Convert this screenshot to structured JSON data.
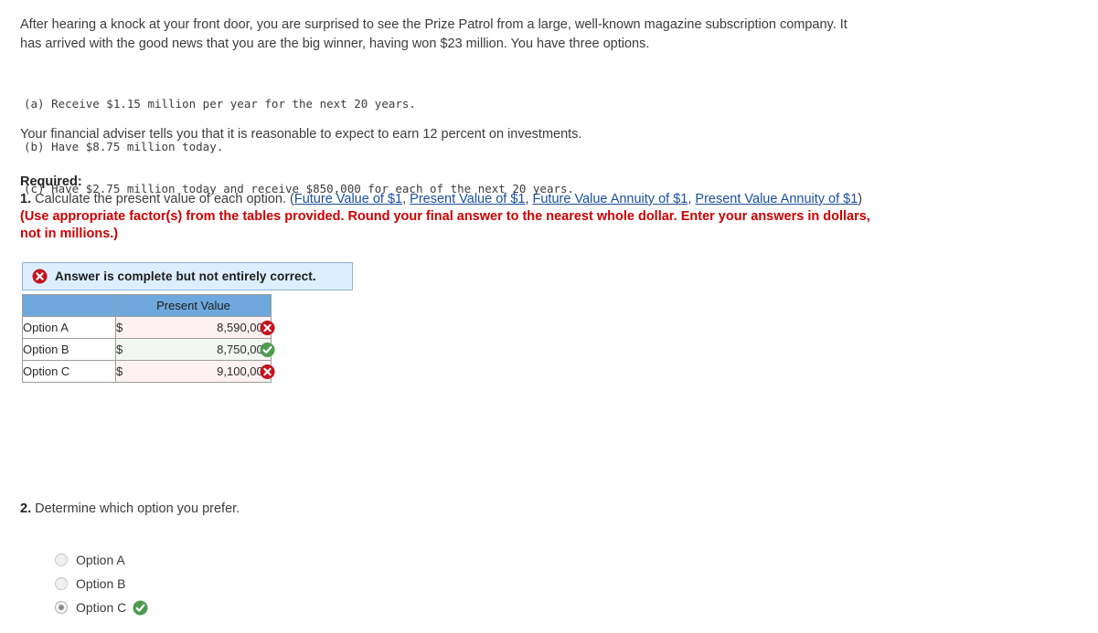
{
  "problem": {
    "intro": "After hearing a knock at your front door, you are surprised to see the Prize Patrol from a large, well-known magazine subscription company. It has arrived with the good news that you are the big winner, having won $23 million. You have three options.",
    "options_mono": [
      "(a) Receive $1.15 million per year for the next 20 years.",
      "(b) Have $8.75 million today.",
      "(c) Have $2.75 million today and receive $850,000 for each of the next 20 years."
    ],
    "adviser_note": "Your financial adviser tells you that it is reasonable to expect to earn 12 percent on investments."
  },
  "required": {
    "label": "Required:",
    "q1_number": "1.",
    "q1_text_before_links": " Calculate the present value of each option. (",
    "links": [
      "Future Value of $1",
      "Present Value of $1",
      "Future Value Annuity of $1",
      "Present Value Annuity of $1"
    ],
    "link_separator": ", ",
    "after_links": ") ",
    "instruction_red": "(Use appropriate factor(s) from the tables provided. Round your final answer to the nearest whole dollar. Enter your answers in dollars, not in millions.)"
  },
  "alert": {
    "icon": "error-circle-icon",
    "message": "Answer is complete but not entirely correct.",
    "bg_color": "#ddeeff",
    "border_color": "#8bb4d8"
  },
  "answer_table": {
    "header_bg": "#6fa8dc",
    "columns": [
      "",
      "Present Value"
    ],
    "rows": [
      {
        "label": "Option A",
        "currency": "$",
        "value": "8,590,000",
        "status": "incorrect"
      },
      {
        "label": "Option B",
        "currency": "$",
        "value": "8,750,000",
        "status": "correct"
      },
      {
        "label": "Option C",
        "currency": "$",
        "value": "9,100,000",
        "status": "incorrect"
      }
    ]
  },
  "question2": {
    "number": "2.",
    "text": " Determine which option you prefer.",
    "choices": [
      {
        "label": "Option A",
        "selected": false,
        "status": ""
      },
      {
        "label": "Option B",
        "selected": false,
        "status": ""
      },
      {
        "label": "Option C",
        "selected": true,
        "status": "correct"
      }
    ]
  },
  "colors": {
    "link": "#1a4fa0",
    "instruction_red": "#cc0000",
    "correct_green": "#4e9a51",
    "incorrect_red": "#c51320"
  }
}
